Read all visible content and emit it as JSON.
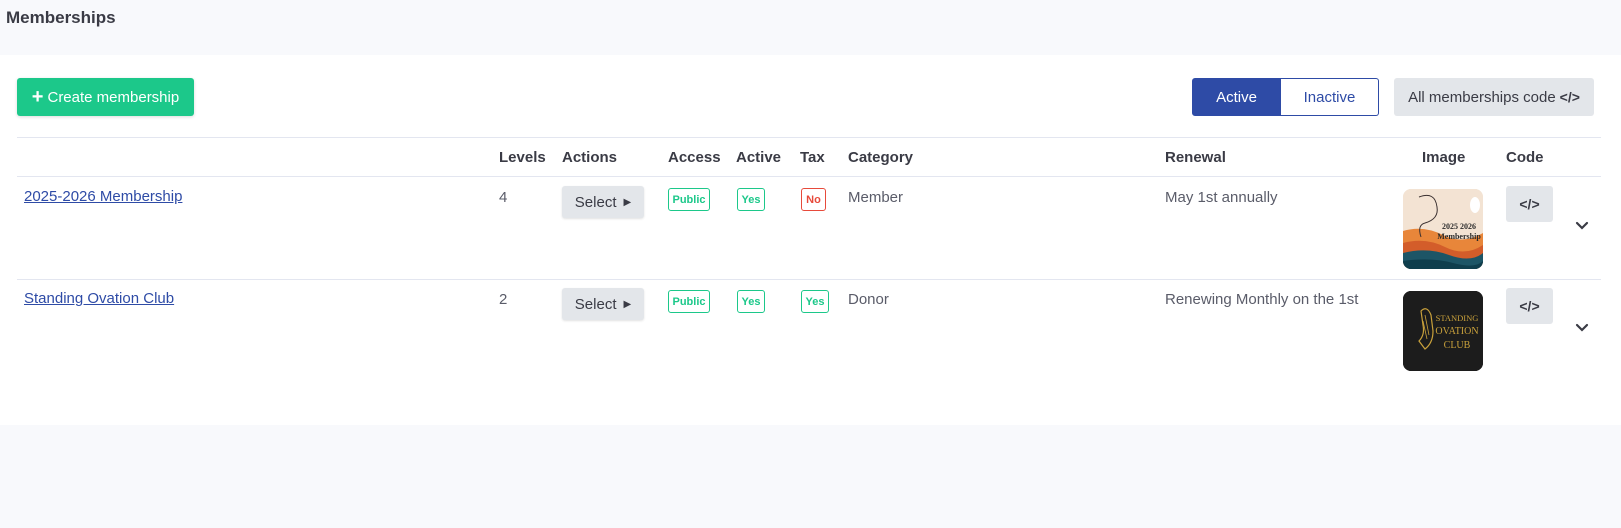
{
  "page": {
    "title": "Memberships"
  },
  "toolbar": {
    "create_label": "Create membership",
    "filter_active": "Active",
    "filter_inactive": "Inactive",
    "all_code_label": "All memberships code",
    "code_glyph": "</>"
  },
  "table": {
    "headers": {
      "levels": "Levels",
      "actions": "Actions",
      "access": "Access",
      "active": "Active",
      "tax": "Tax",
      "category": "Category",
      "renewal": "Renewal",
      "image": "Image",
      "code": "Code"
    },
    "rows": [
      {
        "name": "2025-2026 Membership",
        "levels": "4",
        "action": "Select",
        "access": "Public",
        "active": "Yes",
        "tax": "No",
        "category": "Member",
        "renewal": "May 1st annually",
        "image_text": [
          "2025 2026",
          "Membership"
        ]
      },
      {
        "name": "Standing Ovation Club",
        "levels": "2",
        "action": "Select",
        "access": "Public",
        "active": "Yes",
        "tax": "Yes",
        "category": "Donor",
        "renewal": "Renewing Monthly on the 1st",
        "image_text": [
          "STANDING",
          "OVATION",
          "CLUB"
        ]
      }
    ]
  },
  "colors": {
    "accent_green": "#1cc88a",
    "primary_blue": "#2e4ba6",
    "danger_red": "#e74a3b",
    "page_bg": "#f8f9fc"
  },
  "icons": {
    "plus": "plus-icon",
    "code": "code-icon",
    "caret": "caret-right-icon",
    "chevron": "chevron-down-icon"
  }
}
